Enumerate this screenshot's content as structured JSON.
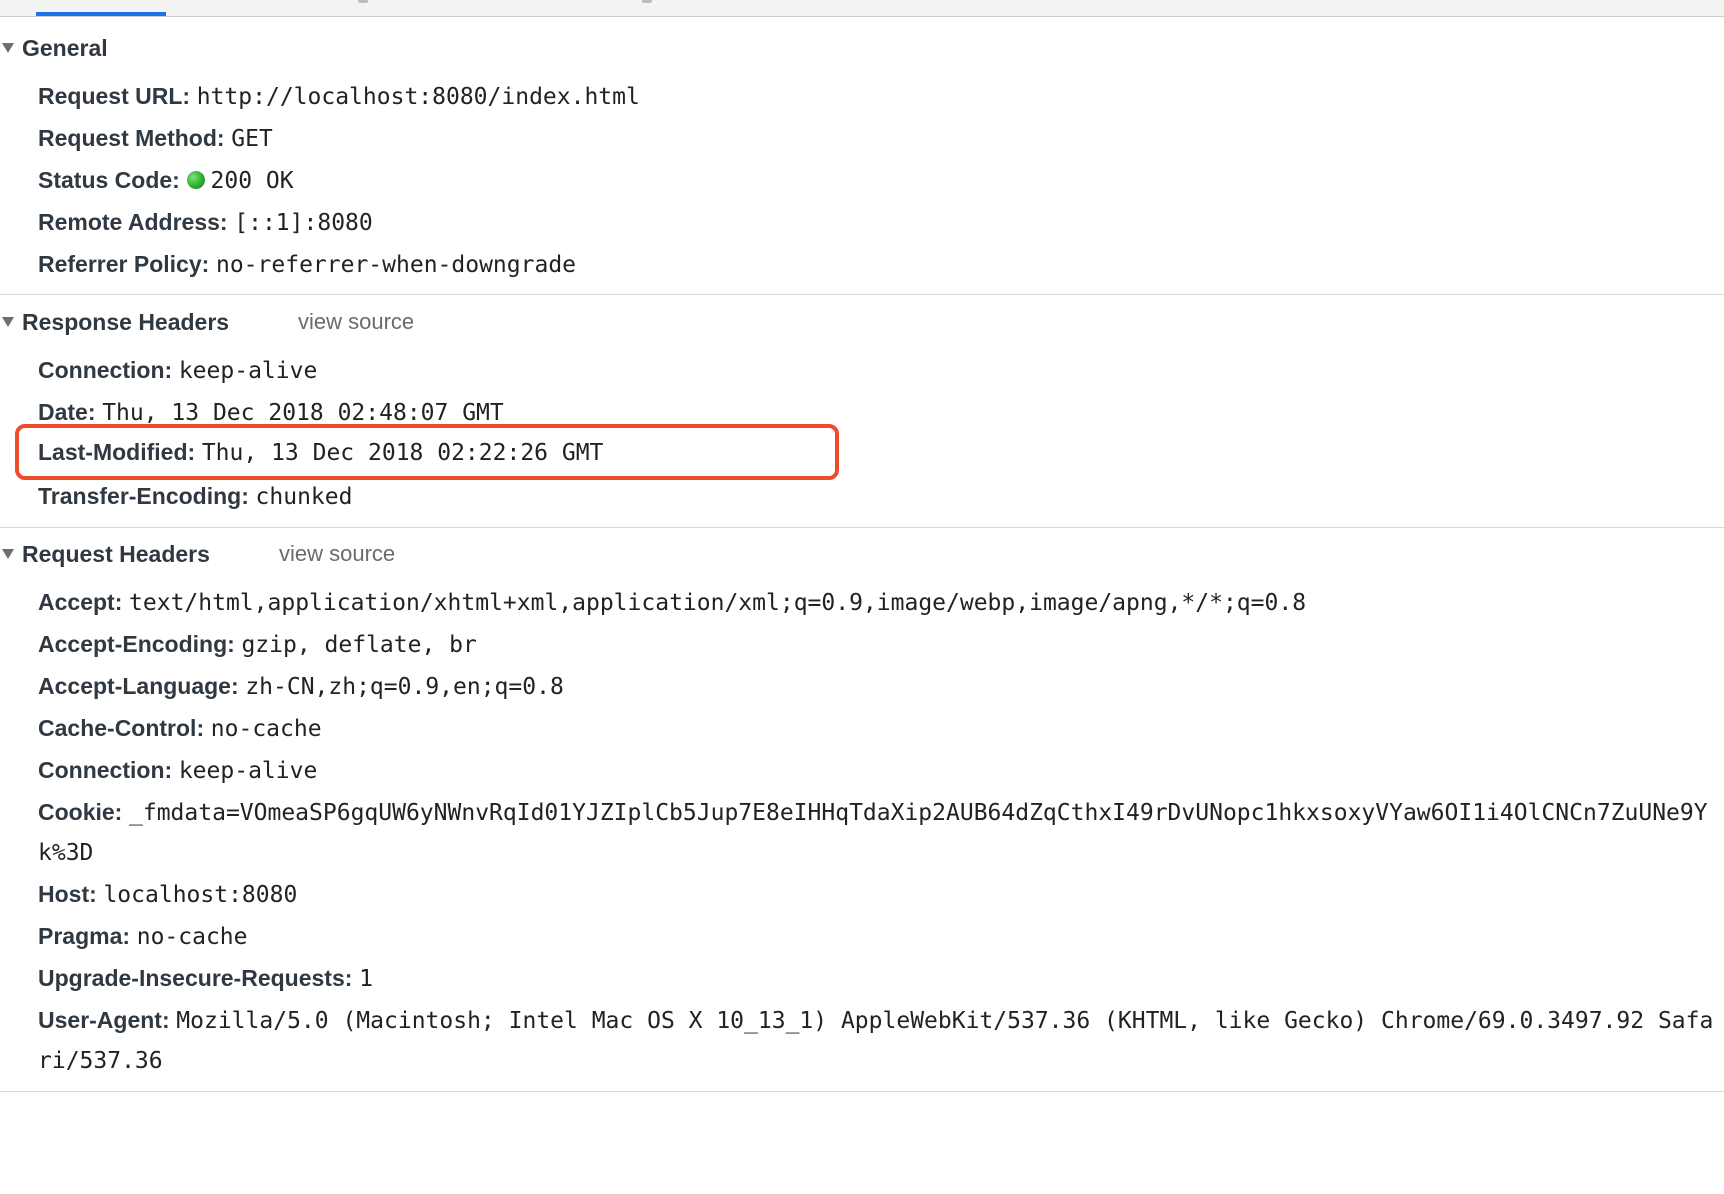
{
  "general": {
    "title": "General",
    "request_url_key": "Request URL:",
    "request_url": "http://localhost:8080/index.html",
    "request_method_key": "Request Method:",
    "request_method": "GET",
    "status_code_key": "Status Code:",
    "status_code": "200 OK",
    "status_color": "#2aa52a",
    "remote_address_key": "Remote Address:",
    "remote_address": "[::1]:8080",
    "referrer_policy_key": "Referrer Policy:",
    "referrer_policy": "no-referrer-when-downgrade"
  },
  "response_headers": {
    "title": "Response Headers",
    "view_source": "view source",
    "items": [
      {
        "key": "Connection:",
        "value": "keep-alive"
      },
      {
        "key": "Date:",
        "value": "Thu, 13 Dec 2018 02:48:07 GMT"
      },
      {
        "key": "Last-Modified:",
        "value": "Thu, 13 Dec 2018 02:22:26 GMT"
      },
      {
        "key": "Transfer-Encoding:",
        "value": "chunked"
      }
    ]
  },
  "request_headers": {
    "title": "Request Headers",
    "view_source": "view source",
    "items": [
      {
        "key": "Accept:",
        "value": "text/html,application/xhtml+xml,application/xml;q=0.9,image/webp,image/apng,*/*;q=0.8"
      },
      {
        "key": "Accept-Encoding:",
        "value": "gzip, deflate, br"
      },
      {
        "key": "Accept-Language:",
        "value": "zh-CN,zh;q=0.9,en;q=0.8"
      },
      {
        "key": "Cache-Control:",
        "value": "no-cache"
      },
      {
        "key": "Connection:",
        "value": "keep-alive"
      },
      {
        "key": "Cookie:",
        "value": "_fmdata=VOmeaSP6gqUW6yNWnvRqId01YJZIplCb5Jup7E8eIHHqTdaXip2AUB64dZqCthxI49rDvUNopc1hkxsoxyVYaw6OI1i4OlCNCn7ZuUNe9Yk%3D"
      },
      {
        "key": "Host:",
        "value": "localhost:8080"
      },
      {
        "key": "Pragma:",
        "value": "no-cache"
      },
      {
        "key": "Upgrade-Insecure-Requests:",
        "value": "1"
      },
      {
        "key": "User-Agent:",
        "value": "Mozilla/5.0 (Macintosh; Intel Mac OS X 10_13_1) AppleWebKit/537.36 (KHTML, like Gecko) Chrome/69.0.3497.92 Safari/537.36"
      }
    ]
  },
  "highlight_color": "#f04a2e"
}
